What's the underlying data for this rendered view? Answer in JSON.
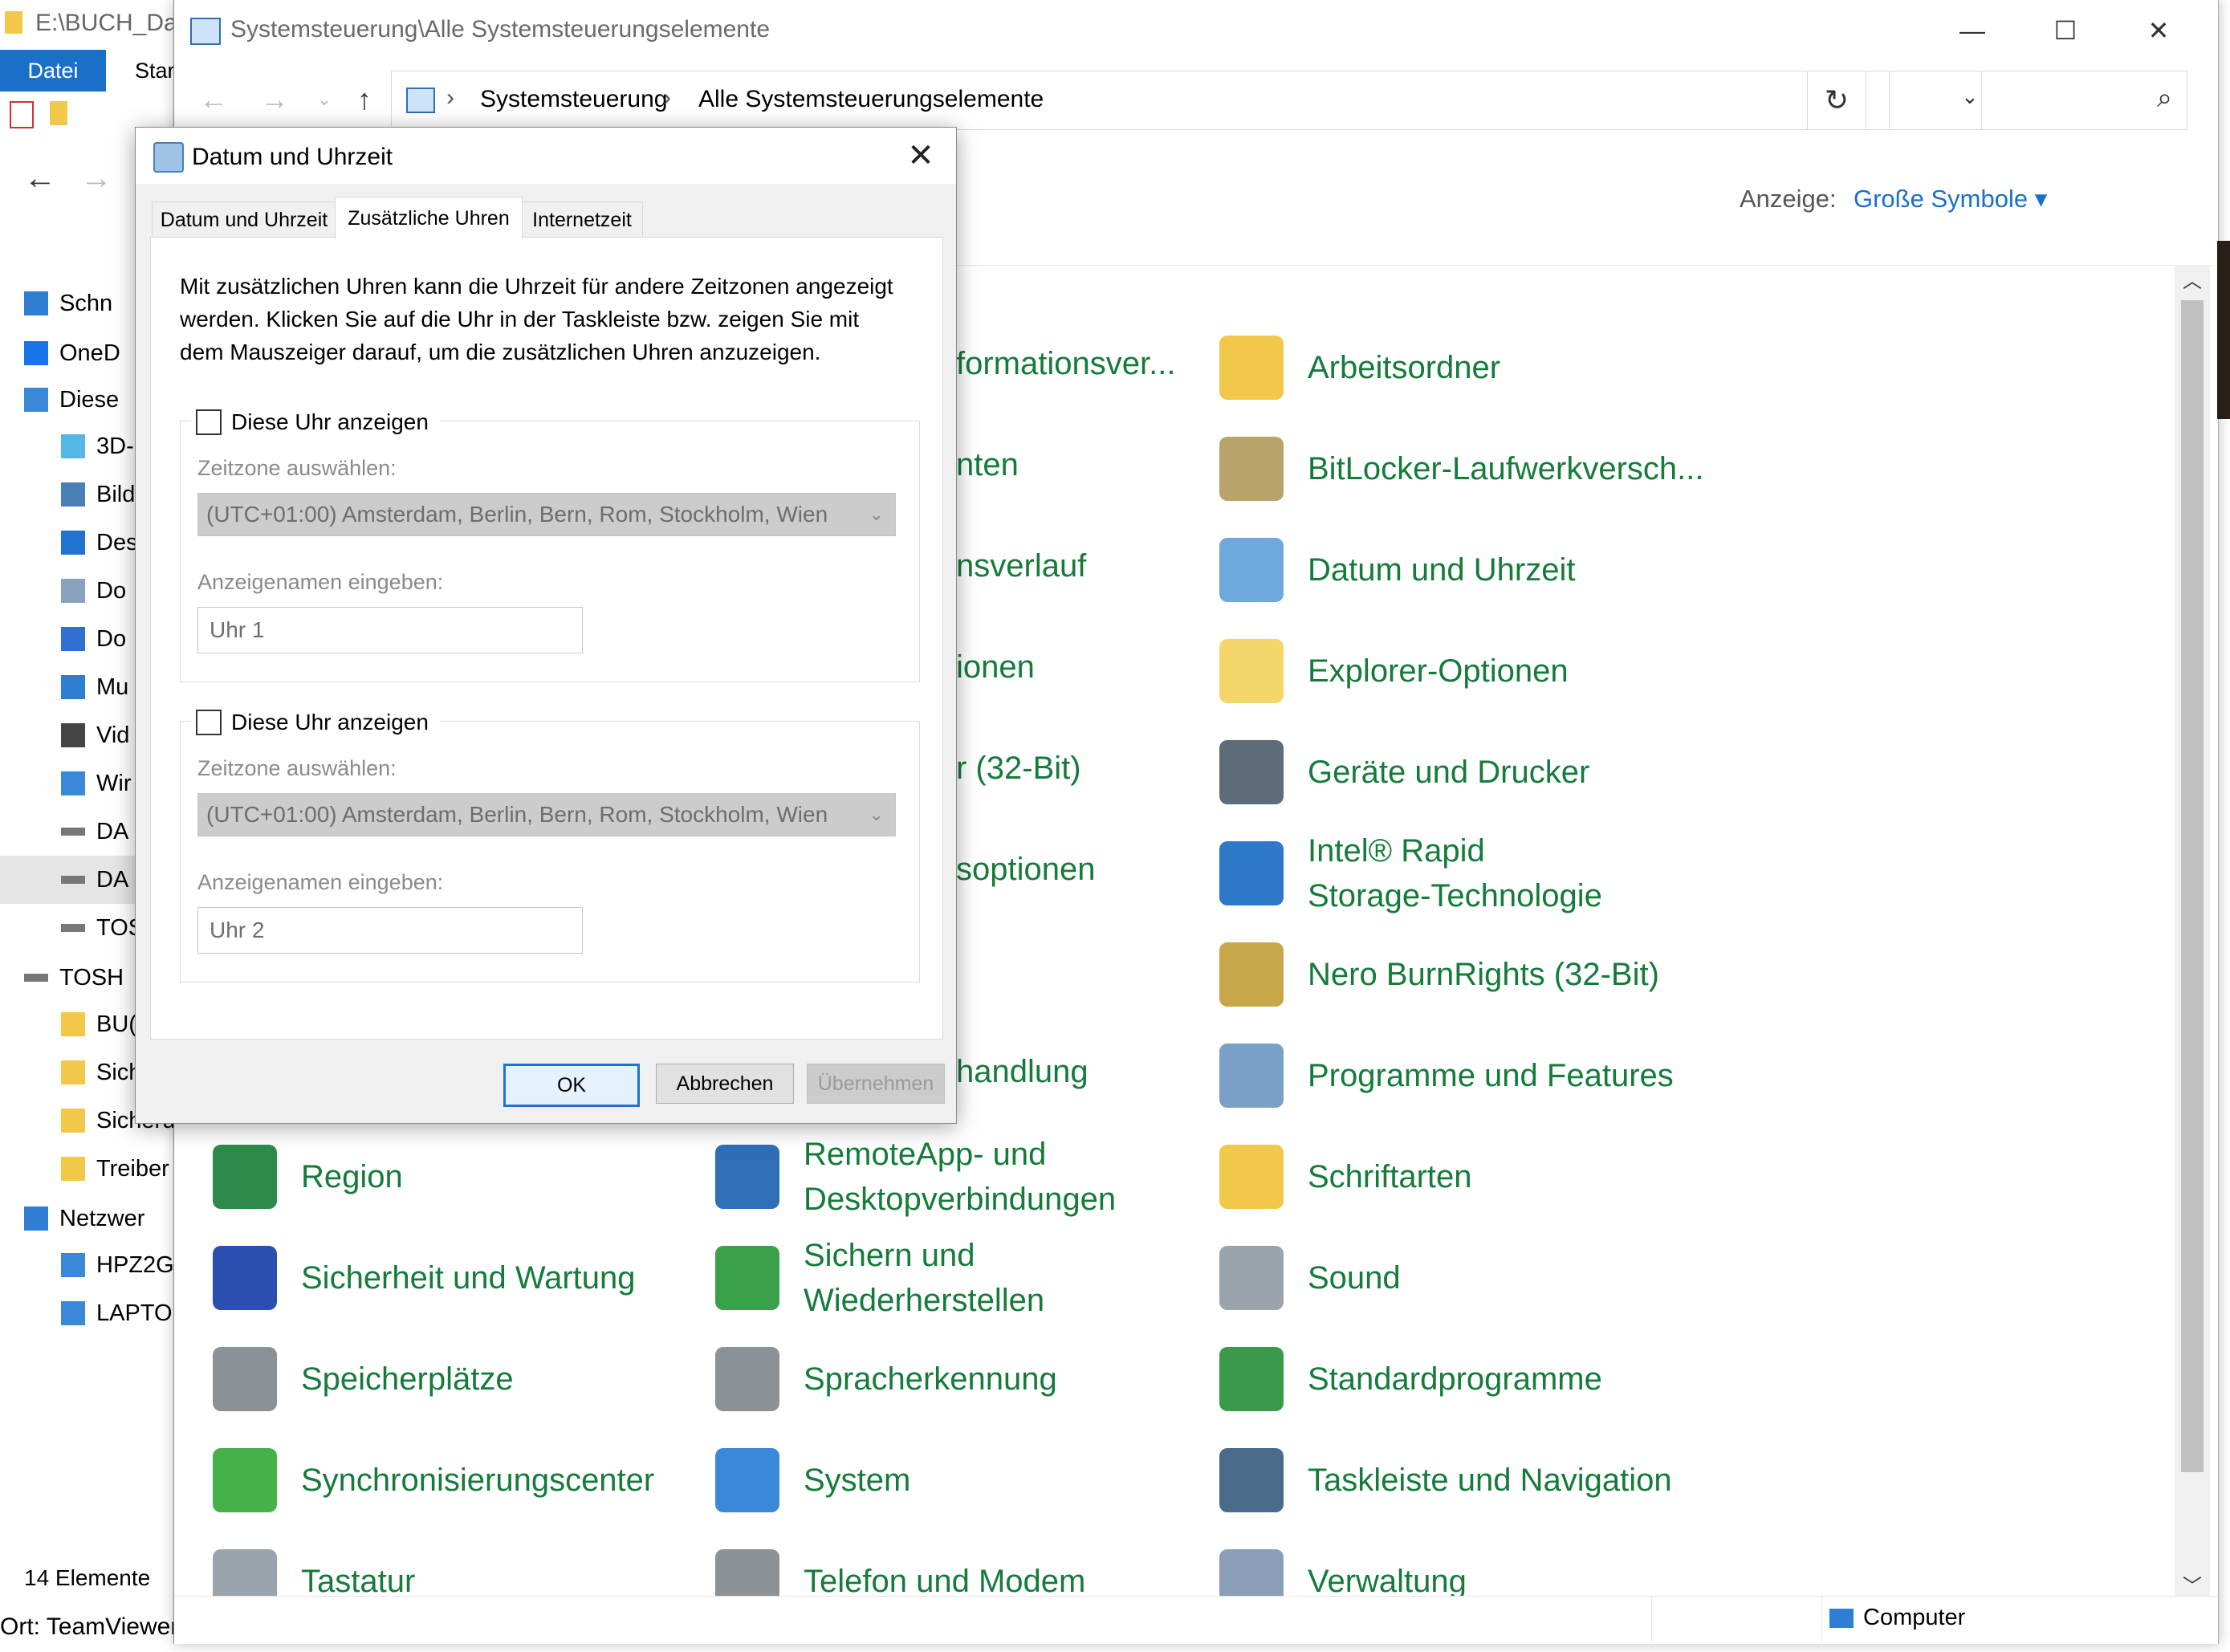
{
  "bg_explorer": {
    "title": "E:\\BUCH_Dat",
    "tab_datei": "Datei",
    "tab_start": "Star",
    "nav_items": [
      {
        "label": "Schn",
        "icon": "star-icon"
      },
      {
        "label": "OneD",
        "icon": "cloud-icon"
      },
      {
        "label": "Diese",
        "icon": "pc-icon"
      },
      {
        "label": "3D-",
        "icon": "cube-icon"
      },
      {
        "label": "Bild",
        "icon": "pictures-icon"
      },
      {
        "label": "Des",
        "icon": "desktop-icon"
      },
      {
        "label": "Do",
        "icon": "documents-icon"
      },
      {
        "label": "Do",
        "icon": "download-icon"
      },
      {
        "label": "Mu",
        "icon": "music-icon"
      },
      {
        "label": "Vid",
        "icon": "video-icon"
      },
      {
        "label": "Wir",
        "icon": "windows-drive-icon"
      },
      {
        "label": "DA",
        "icon": "drive-icon"
      },
      {
        "label": "DA",
        "icon": "drive-icon"
      },
      {
        "label": "TOS",
        "icon": "drive-icon"
      },
      {
        "label": "TOSH",
        "icon": "drive-icon"
      },
      {
        "label": "BU(",
        "icon": "folder-icon"
      },
      {
        "label": "Sich",
        "icon": "folder-icon"
      },
      {
        "label": "Sicheru",
        "icon": "folder-icon"
      },
      {
        "label": "Treiber",
        "icon": "folder-icon"
      },
      {
        "label": "Netzwer",
        "icon": "network-icon"
      },
      {
        "label": "HPZ2G",
        "icon": "computer-icon"
      },
      {
        "label": "LAPTOI",
        "icon": "computer-icon"
      }
    ],
    "status_count": "14 Elemente",
    "status_location": "Ort: TeamViewer"
  },
  "cp_window": {
    "title": "Systemsteuerung\\Alle Systemsteuerungselemente",
    "breadcrumb": [
      "Systemsteuerung",
      "Alle Systemsteuerungselemente"
    ],
    "search_placeholder": "",
    "view_label": "Anzeige:",
    "view_value": "Große Symbole ▾",
    "status_computer": "Computer",
    "items": {
      "col2": [
        {
          "label": "formationsver...",
          "icon": "info-icon"
        },
        {
          "label": "nten",
          "icon": "color-icon"
        },
        {
          "label": "nsverlauf",
          "icon": "history-icon"
        },
        {
          "label": "ionen",
          "icon": "options-icon"
        },
        {
          "label": "r (32-Bit)",
          "icon": "flash-icon"
        },
        {
          "label": "soptionen",
          "icon": "power-icon"
        },
        {
          "label": "handlung",
          "icon": "handling-icon"
        }
      ],
      "col3": [
        {
          "label": "Arbeitsordner",
          "icon": "work-folders-icon"
        },
        {
          "label": "BitLocker-Laufwerkversch...",
          "icon": "bitlocker-icon"
        },
        {
          "label": "Datum und Uhrzeit",
          "icon": "datetime-icon"
        },
        {
          "label": "Explorer-Optionen",
          "icon": "explorer-options-icon"
        },
        {
          "label": "Geräte und Drucker",
          "icon": "printer-icon"
        },
        {
          "label": "Intel® Rapid\nStorage-Technologie",
          "icon": "intel-rst-icon"
        },
        {
          "label": "Nero BurnRights (32-Bit)",
          "icon": "nero-icon"
        },
        {
          "label": "Programme und Features",
          "icon": "programs-icon"
        },
        {
          "label": "Schriftarten",
          "icon": "fonts-icon"
        },
        {
          "label": "Sound",
          "icon": "sound-icon"
        },
        {
          "label": "Standardprogramme",
          "icon": "default-programs-icon"
        },
        {
          "label": "Taskleiste und Navigation",
          "icon": "taskbar-icon"
        },
        {
          "label": "Verwaltung",
          "icon": "admin-tools-icon"
        }
      ],
      "col1_bottom": [
        {
          "label": "Region",
          "icon": "globe-icon"
        },
        {
          "label": "Sicherheit und Wartung",
          "icon": "flag-icon"
        },
        {
          "label": "Speicherplätze",
          "icon": "storage-icon"
        },
        {
          "label": "Synchronisierungscenter",
          "icon": "sync-icon"
        },
        {
          "label": "Tastatur",
          "icon": "keyboard-icon"
        }
      ],
      "col2_bottom": [
        {
          "label": "RemoteApp- und\nDesktopverbindungen",
          "icon": "remote-icon"
        },
        {
          "label": "Sichern und\nWiederherstellen",
          "icon": "backup-icon"
        },
        {
          "label": "Spracherkennung",
          "icon": "microphone-icon"
        },
        {
          "label": "System",
          "icon": "system-icon"
        },
        {
          "label": "Telefon und Modem",
          "icon": "phone-icon"
        }
      ]
    }
  },
  "dialog": {
    "title": "Datum und Uhrzeit",
    "tabs": [
      "Datum und Uhrzeit",
      "Zusätzliche Uhren",
      "Internetzeit"
    ],
    "intro": "Mit zusätzlichen Uhren kann die Uhrzeit für andere Zeitzonen angezeigt werden. Klicken Sie auf die Uhr in der Taskleiste bzw. zeigen Sie mit dem Mauszeiger darauf, um die zusätzlichen Uhren anzuzeigen.",
    "clock1": {
      "checkbox_label": "Diese Uhr anzeigen",
      "zone_label": "Zeitzone auswählen:",
      "zone_value": "(UTC+01:00) Amsterdam, Berlin, Bern, Rom, Stockholm, Wien",
      "name_label": "Anzeigenamen eingeben:",
      "name_value": "Uhr 1"
    },
    "clock2": {
      "checkbox_label": "Diese Uhr anzeigen",
      "zone_label": "Zeitzone auswählen:",
      "zone_value": "(UTC+01:00) Amsterdam, Berlin, Bern, Rom, Stockholm, Wien",
      "name_label": "Anzeigenamen eingeben:",
      "name_value": "Uhr 2"
    },
    "buttons": {
      "ok": "OK",
      "cancel": "Abbrechen",
      "apply": "Übernehmen"
    }
  }
}
